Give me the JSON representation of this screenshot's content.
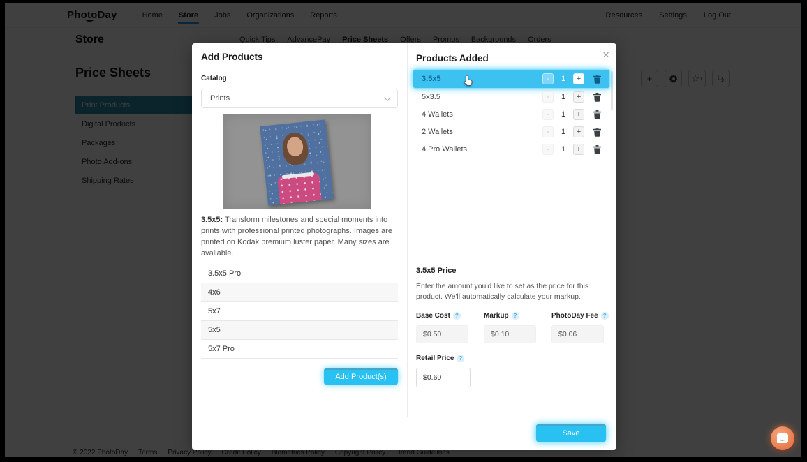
{
  "nav": {
    "logo": "PhotoDay",
    "items": [
      "Home",
      "Store",
      "Jobs",
      "Organizations",
      "Reports"
    ],
    "right_items": [
      "Resources",
      "Settings",
      "Log Out"
    ],
    "active_item": "Store"
  },
  "page": {
    "title": "Store",
    "section_title": "Price Sheets",
    "tabs": [
      "Quick Tips",
      "AdvancePay",
      "Price Sheets",
      "Offers",
      "Promos",
      "Backgrounds",
      "Orders"
    ],
    "active_tab": "Price Sheets",
    "sidebar_items": [
      "Print Products",
      "Digital Products",
      "Packages",
      "Photo Add-ons",
      "Shipping Rates"
    ],
    "active_sidebar_item": "Print Products",
    "toolbar_icons": [
      "plus-icon",
      "gear-icon",
      "star-icon",
      "export-icon"
    ]
  },
  "modal": {
    "close_label": "×",
    "left": {
      "title": "Add Products",
      "catalog_label": "Catalog",
      "catalog_value": "Prints",
      "description_bold": "3.5x5:",
      "description_text": " Transform milestones and special moments into prints with professional printed photographs. Images are printed on Kodak premium luster paper. Many sizes are available.",
      "products": [
        "3.5x5 Pro",
        "4x6",
        "5x7",
        "5x5",
        "5x7 Pro"
      ],
      "add_button_label": "Add Product(s)"
    },
    "right": {
      "title": "Products Added",
      "controls": {
        "minus": "-",
        "plus": "+"
      },
      "items": [
        {
          "name": "3.5x5",
          "qty": "1",
          "selected": true
        },
        {
          "name": "5x3.5",
          "qty": "1",
          "selected": false
        },
        {
          "name": "4 Wallets",
          "qty": "1",
          "selected": false
        },
        {
          "name": "2 Wallets",
          "qty": "1",
          "selected": false
        },
        {
          "name": "4 Pro Wallets",
          "qty": "1",
          "selected": false
        }
      ],
      "price": {
        "title": "3.5x5 Price",
        "description": "Enter the amount you'd like to set as the price for this product. We'll automatically calculate your markup.",
        "help_glyph": "?",
        "fields": [
          {
            "label": "Base Cost",
            "value": "$0.50"
          },
          {
            "label": "Markup",
            "value": "$0.10"
          },
          {
            "label": "PhotoDay Fee",
            "value": "$0.06"
          },
          {
            "label": "Retail Price",
            "value": "$0.60"
          }
        ]
      },
      "save_button_label": "Save"
    }
  },
  "footer": {
    "items": [
      "© 2022 PhotoDay",
      "Terms",
      "Privacy Policy",
      "Credit Policy",
      "Biometrics Policy",
      "Copyright Policy",
      "Brand Guidelines"
    ]
  },
  "colors": {
    "accent_blue": "#29c0f2",
    "selected_row_blue": "#3cc1f1",
    "sidebar_active_teal": "#2d8fae",
    "chat_orange": "#e8794a"
  }
}
